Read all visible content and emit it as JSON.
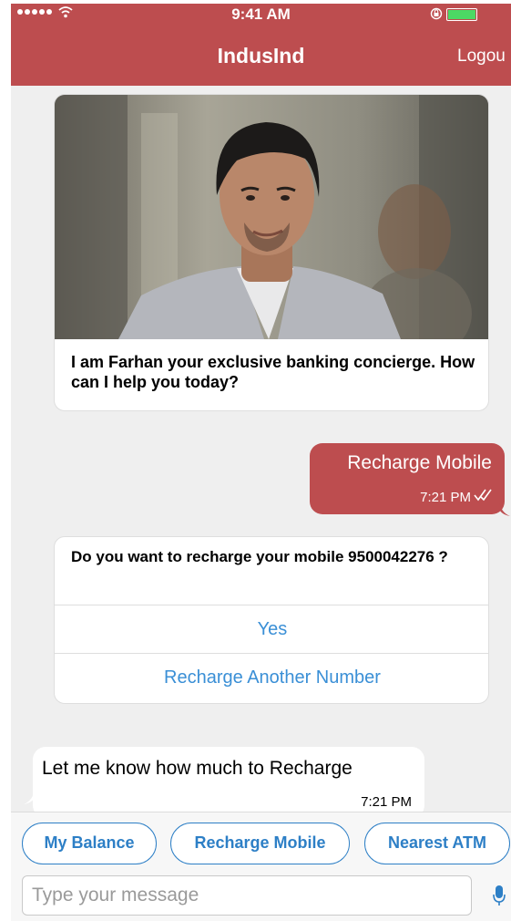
{
  "status_bar": {
    "time": "9:41 AM"
  },
  "nav": {
    "title": "IndusInd",
    "logout_label": "Logou"
  },
  "messages": {
    "intro": {
      "text": "I am Farhan your exclusive banking concierge. How can I help you today?"
    },
    "user_message": {
      "text": "Recharge Mobile",
      "time": "7:21 PM"
    },
    "question": {
      "text": "Do you want to recharge your mobile 9500042276 ?",
      "options": [
        "Yes",
        "Recharge Another Number"
      ]
    },
    "bot_reply": {
      "text": "Let me know how much to Recharge",
      "time": "7:21 PM"
    }
  },
  "quick_replies": [
    "My Balance",
    "Recharge Mobile",
    "Nearest ATM"
  ],
  "composer": {
    "placeholder": "Type your message"
  },
  "colors": {
    "brand": "#bd4d4f",
    "link": "#3a8fd6",
    "chip": "#2d7fc6",
    "battery": "#4cd964"
  },
  "icons": [
    "signal-dots-icon",
    "wifi-icon",
    "lock-rotation-icon",
    "battery-icon",
    "read-ticks-icon",
    "microphone-icon"
  ]
}
